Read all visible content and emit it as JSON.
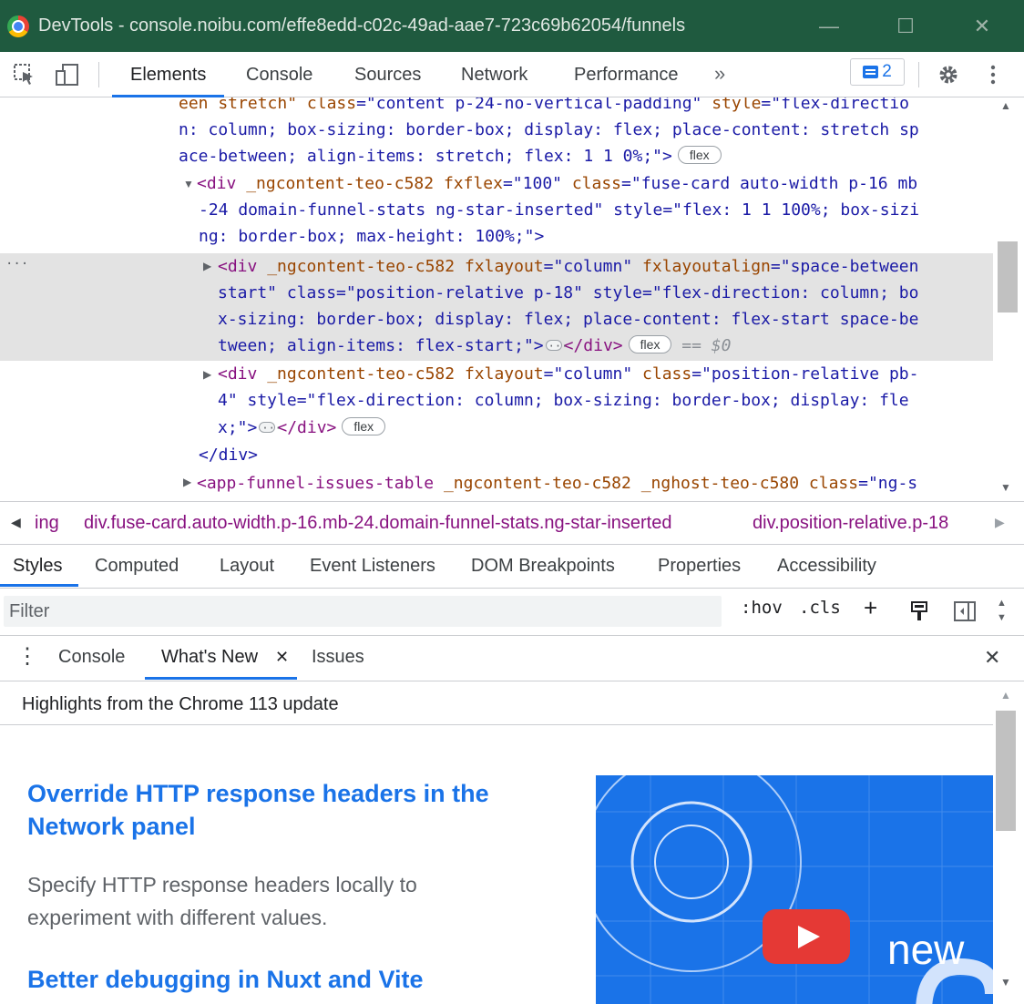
{
  "window": {
    "title": "DevTools - console.noibu.com/effe8edd-c02c-49ad-aae7-723c69b62054/funnels",
    "minimize": "—",
    "maximize": "☐",
    "close": "✕"
  },
  "toolbar": {
    "tabs": [
      "Elements",
      "Console",
      "Sources",
      "Network",
      "Performance"
    ],
    "more": "»",
    "issues_count": "2"
  },
  "dom_lines": {
    "l1": {
      "pre": "een stretch\" ",
      "a1": "class",
      "v1": "=\"content p-24-no-vertical-padding\" ",
      "a2": "style",
      "v2": "=\"flex-directio"
    },
    "l2": "n: column; box-sizing: border-box; display: flex; place-content: stretch sp",
    "l3": "ace-between; align-items: stretch; flex: 1 1 0%;\">",
    "l4": {
      "tag": "<div ",
      "a1": "_ngcontent-teo-c582 ",
      "a2": "fxflex",
      "v2": "=\"100\" ",
      "a3": "class",
      "v3": "=\"fuse-card auto-width p-16 mb"
    },
    "l5": "-24 domain-funnel-stats ng-star-inserted\" style=\"flex: 1 1 100%; box-sizi",
    "l6": "ng: border-box; max-height: 100%;\">",
    "l7": {
      "tag": "<div ",
      "a1": "_ngcontent-teo-c582 ",
      "a2": "fxlayout",
      "v2": "=\"column\" ",
      "a3": "fxlayoutalign",
      "v3": "=\"space-between"
    },
    "l8": "start\" class=\"position-relative p-18\" style=\"flex-direction: column; bo",
    "l9": "x-sizing: border-box; display: flex; place-content: flex-start space-be",
    "l10": "tween; align-items: flex-start;\">",
    "l10_close": "</div>",
    "l10_sel": "== $0",
    "l11": {
      "tag": "<div ",
      "a1": "_ngcontent-teo-c582 ",
      "a2": "fxlayout",
      "v2": "=\"column\" ",
      "a3": "class",
      "v3": "=\"position-relative pb-"
    },
    "l12": "4\" style=\"flex-direction: column; box-sizing: border-box; display: fle",
    "l13": "x;\">",
    "l13_close": "</div>",
    "l14": "</div>",
    "l15": {
      "tag": "<app-funnel-issues-table ",
      "a1": "_ngcontent-teo-c582 ",
      "a2": "_nghost-teo-c580 ",
      "a3": "class",
      "v3": "=\"ng-s"
    },
    "flex_pill": "flex",
    "gutter_dots": "···"
  },
  "breadcrumb": {
    "left_arrow": "◀",
    "right_arrow": "▶",
    "items": [
      "ing",
      "div.fuse-card.auto-width.p-16.mb-24.domain-funnel-stats.ng-star-inserted",
      "div.position-relative.p-18"
    ]
  },
  "subtabs": [
    "Styles",
    "Computed",
    "Layout",
    "Event Listeners",
    "DOM Breakpoints",
    "Properties",
    "Accessibility"
  ],
  "filter": {
    "placeholder": "Filter",
    "hov": ":hov",
    "cls": ".cls",
    "plus": "+"
  },
  "drawer": {
    "menu": "⋮",
    "tabs": [
      "Console",
      "What's New",
      "Issues"
    ],
    "tab_close": "✕",
    "close": "✕",
    "highlights": "Highlights from the Chrome 113 update",
    "articles": [
      {
        "title": "Override HTTP response headers in the Network panel",
        "body": "Specify HTTP response headers locally to experiment with different values."
      },
      {
        "title": "Better debugging in Nuxt and Vite"
      }
    ],
    "promo_text": "new"
  },
  "colors": {
    "titlebar": "#1f5a3f",
    "accent": "#1a73e8",
    "tag": "#881280",
    "attr": "#994500",
    "value": "#1a1aa6"
  }
}
